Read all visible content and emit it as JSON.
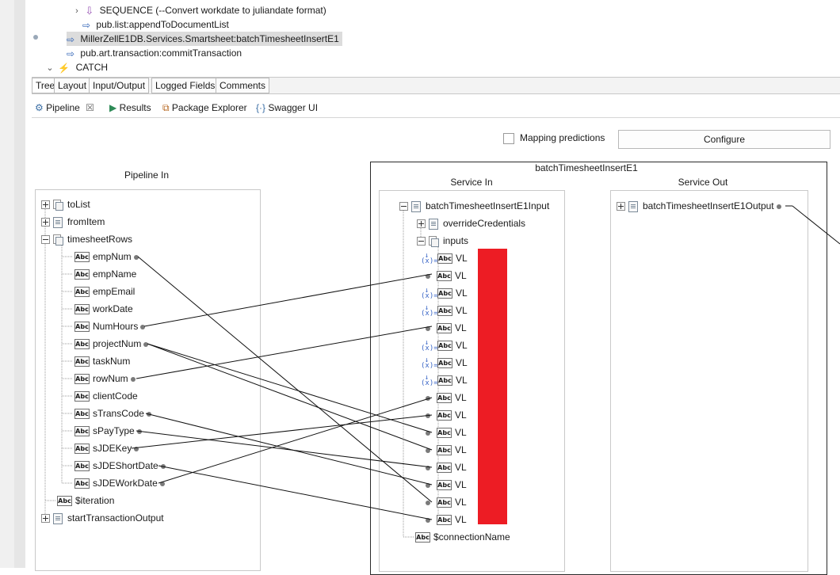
{
  "editor": {
    "rows": [
      {
        "label": "SEQUENCE (--Convert workdate to juliandate format)",
        "icon": "sequence-icon"
      },
      {
        "label": "pub.list:appendToDocumentList",
        "icon": "invoke-arrow-icon"
      },
      {
        "label": "MillerZellE1DB.Services.Smartsheet:batchTimesheetInsertE1",
        "icon": "invoke-arrow-icon"
      },
      {
        "label": "pub.art.transaction:commitTransaction",
        "icon": "invoke-arrow-icon"
      },
      {
        "label": "CATCH",
        "icon": "lightning-icon"
      }
    ]
  },
  "view_tabs": [
    "Tree",
    "Layout",
    "Input/Output",
    "Logged Fields",
    "Comments"
  ],
  "panel_tabs": [
    "Pipeline",
    "Results",
    "Package Explorer",
    "Swagger UI"
  ],
  "mapping_predictions_label": "Mapping predictions",
  "configure_label": "Configure",
  "pipeline_in": {
    "title": "Pipeline In",
    "tolist": "toList",
    "fromitem": "fromItem",
    "timesheetrows": "timesheetRows",
    "fields": [
      "empNum",
      "empName",
      "empEmail",
      "workDate",
      "NumHours",
      "projectNum",
      "taskNum",
      "rowNum",
      "clientCode",
      "sTransCode",
      "sPayType",
      "sJDEKey",
      "sJDEShortDate",
      "sJDEWorkDate"
    ],
    "iteration": "$iteration",
    "starttx": "startTransactionOutput"
  },
  "service": {
    "title": "batchTimesheetInsertE1",
    "in_title": "Service In",
    "out_title": "Service Out",
    "input_doc": "batchTimesheetInsertE1Input",
    "override": "overrideCredentials",
    "inputs": "inputs",
    "vl_prefix": "VL",
    "connection": "$connectionName",
    "output_doc": "batchTimesheetInsertE1Output"
  },
  "icon_text": {
    "abc": "Abc"
  }
}
